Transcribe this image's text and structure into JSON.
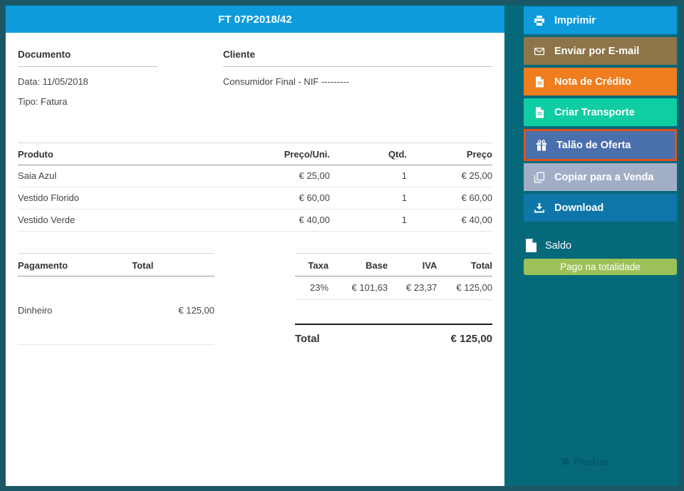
{
  "header": {
    "title": "FT 07P2018/42"
  },
  "document_info": {
    "section_title": "Documento",
    "date_line": "Data: 11/05/2018",
    "type_line": "Tipo: Fatura"
  },
  "client_info": {
    "section_title": "Cliente",
    "name": "Consumidor Final - NIF ---------"
  },
  "products": {
    "headers": [
      "Produto",
      "Preço/Uni.",
      "Qtd.",
      "Preço"
    ],
    "rows": [
      {
        "name": "Saia Azul",
        "unit_price": "€ 25,00",
        "qty": "1",
        "price": "€ 25,00"
      },
      {
        "name": "Vestido Florido",
        "unit_price": "€ 60,00",
        "qty": "1",
        "price": "€ 60,00"
      },
      {
        "name": "Vestido Verde",
        "unit_price": "€ 40,00",
        "qty": "1",
        "price": "€ 40,00"
      }
    ]
  },
  "payment": {
    "headers": [
      "Pagamento",
      "Total"
    ],
    "rows": [
      {
        "method": "Dinheiro",
        "total": "€ 125,00"
      }
    ]
  },
  "tax": {
    "headers": [
      "Taxa",
      "Base",
      "IVA",
      "Total"
    ],
    "rows": [
      {
        "rate": "23%",
        "base": "€ 101,63",
        "iva": "€ 23,37",
        "total": "€ 125,00"
      }
    ]
  },
  "grand_total": {
    "label": "Total",
    "value": "€ 125,00"
  },
  "sidebar": {
    "actions": [
      {
        "label": "Imprimir",
        "icon": "printer-icon",
        "color": "#0d9bdc"
      },
      {
        "label": "Enviar por E-mail",
        "icon": "envelope-icon",
        "color": "#8d7449"
      },
      {
        "label": "Nota de Crédito",
        "icon": "file-text-icon",
        "color": "#f07d1e"
      },
      {
        "label": "Criar Transporte",
        "icon": "file-text-icon",
        "color": "#10cda3"
      },
      {
        "label": "Talão de Oferta",
        "icon": "gift-icon",
        "color": "#4a6fad",
        "border_color": "#e0511d",
        "highlighted": true
      },
      {
        "label": "Copiar para a Venda",
        "icon": "copy-icon",
        "color": "#a2aec5"
      },
      {
        "label": "Download",
        "icon": "download-icon",
        "color": "#0e76a9"
      }
    ],
    "saldo": {
      "label": "Saldo",
      "status": "Pago na totalidade",
      "status_color": "#9cc158"
    }
  },
  "footer": {
    "close_label": "Fechar"
  },
  "theme": {
    "background": "#05697a",
    "frame_border": "#1c5765",
    "header_blue": "#0d9bdc"
  }
}
